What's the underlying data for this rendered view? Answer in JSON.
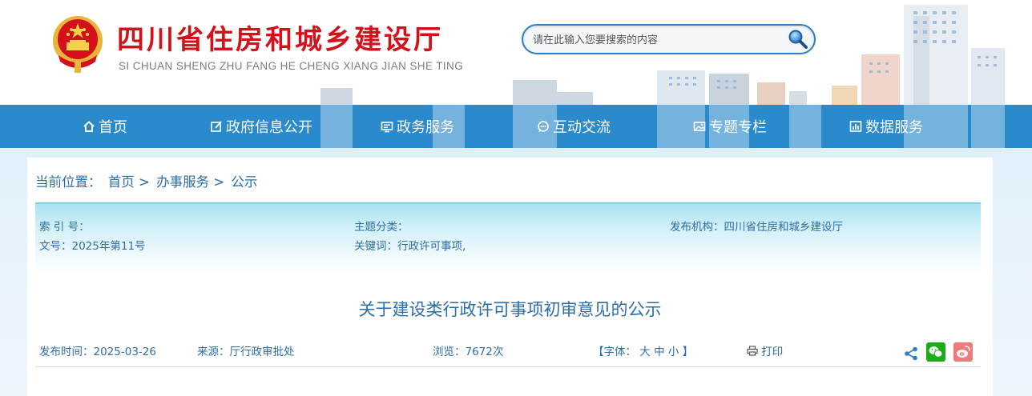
{
  "header": {
    "site_title": "四川省住房和城乡建设厅",
    "site_pinyin": "SI CHUAN SHENG ZHU FANG HE CHENG XIANG JIAN SHE TING",
    "search_placeholder": "请在此输入您要搜索的内容"
  },
  "nav": {
    "items": [
      {
        "label": "首页",
        "icon": "home-icon"
      },
      {
        "label": "政府信息公开",
        "icon": "edit-icon"
      },
      {
        "label": "政务服务",
        "icon": "monitor-icon"
      },
      {
        "label": "互动交流",
        "icon": "chat-icon"
      },
      {
        "label": "专题专栏",
        "icon": "image-icon"
      },
      {
        "label": "数据服务",
        "icon": "chart-icon"
      }
    ]
  },
  "breadcrumb": {
    "prefix": "当前位置：",
    "items": [
      "首页",
      "办事服务",
      "公示"
    ],
    "separator": ">"
  },
  "meta": {
    "index_no": "索 引 号：",
    "category": "主题分类：",
    "publisher": "发布机构：四川省住房和城乡建设厅",
    "doc_no": "文号：2025年第11号",
    "keywords": "关键词：行政许可事项,"
  },
  "article": {
    "title": "关于建设类行政许可事项初审意见的公示",
    "publish_time": "发布时间：2025-03-26",
    "source": "来源：厅行政审批处",
    "views": "浏览：7672次",
    "font_label": "【字体：",
    "font_large": "大",
    "font_medium": "中",
    "font_small": "小",
    "font_end": "】",
    "print_label": "打印"
  },
  "colors": {
    "brand_red": "#d4111b",
    "nav_blue": "#2a8acb",
    "text_blue": "#2c6ea6",
    "wechat_green": "#1aad19",
    "weibo_pink": "#f2787a"
  }
}
